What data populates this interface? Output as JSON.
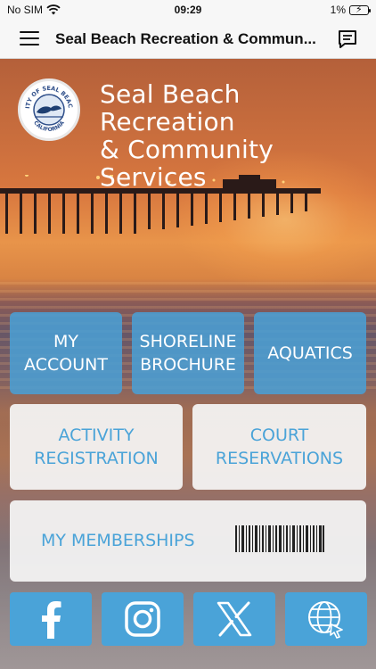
{
  "status_bar": {
    "carrier": "No SIM",
    "time": "09:29",
    "battery": "1%"
  },
  "nav": {
    "title": "Seal Beach Recreation & Commun..."
  },
  "brand": {
    "line1": "Seal Beach Recreation",
    "line2": "& Community Services",
    "logo_top_text": "CITY OF SEAL BEACH",
    "logo_bottom_text": "CALIFORNIA"
  },
  "tiles": {
    "my_account": [
      "MY",
      "ACCOUNT"
    ],
    "shoreline_brochure": [
      "SHORELINE",
      "BROCHURE"
    ],
    "aquatics": "AQUATICS",
    "activity_registration": [
      "ACTIVITY",
      "REGISTRATION"
    ],
    "court_reservations": [
      "COURT",
      "RESERVATIONS"
    ],
    "my_memberships": "MY MEMBERSHIPS"
  },
  "social": {
    "icons": [
      "facebook-icon",
      "instagram-icon",
      "x-icon",
      "website-icon"
    ]
  },
  "colors": {
    "accent_blue": "#4aa3d8",
    "nav_background": "#f7f7f7"
  }
}
